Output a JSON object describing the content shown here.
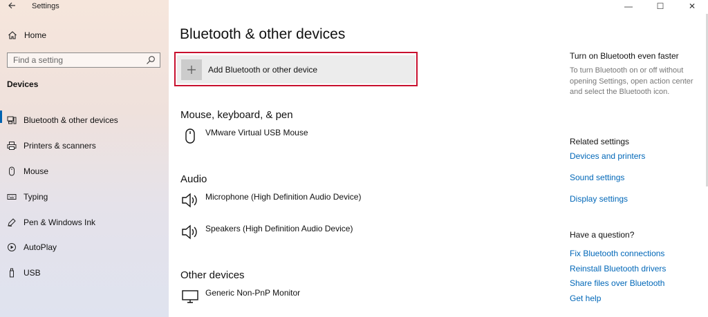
{
  "window": {
    "app_title": "Settings",
    "controls": {
      "minimize": "—",
      "maximize": "☐",
      "close": "✕"
    }
  },
  "sidebar": {
    "home_label": "Home",
    "search": {
      "placeholder": "Find a setting",
      "value": ""
    },
    "section_heading": "Devices",
    "items": [
      {
        "label": "Bluetooth & other devices",
        "icon": "bluetooth-devices-icon",
        "active": true
      },
      {
        "label": "Printers & scanners",
        "icon": "printer-icon",
        "active": false
      },
      {
        "label": "Mouse",
        "icon": "mouse-icon",
        "active": false
      },
      {
        "label": "Typing",
        "icon": "keyboard-icon",
        "active": false
      },
      {
        "label": "Pen & Windows Ink",
        "icon": "pen-icon",
        "active": false
      },
      {
        "label": "AutoPlay",
        "icon": "autoplay-icon",
        "active": false
      },
      {
        "label": "USB",
        "icon": "usb-icon",
        "active": false
      }
    ]
  },
  "main": {
    "title": "Bluetooth & other devices",
    "add_button_label": "Add Bluetooth or other device",
    "groups": [
      {
        "title": "Mouse, keyboard, & pen",
        "devices": [
          {
            "label": "VMware Virtual USB Mouse",
            "icon": "mouse-icon"
          }
        ]
      },
      {
        "title": "Audio",
        "devices": [
          {
            "label": "Microphone (High Definition Audio Device)",
            "icon": "speaker-icon"
          },
          {
            "label": "Speakers (High Definition Audio Device)",
            "icon": "speaker-icon"
          }
        ]
      },
      {
        "title": "Other devices",
        "devices": [
          {
            "label": "Generic Non-PnP Monitor",
            "icon": "monitor-icon"
          }
        ]
      }
    ]
  },
  "right": {
    "tip_heading": "Turn on Bluetooth even faster",
    "tip_text": "To turn Bluetooth on or off without opening Settings, open action center and select the Bluetooth icon.",
    "related_heading": "Related settings",
    "related_links": [
      "Devices and printers",
      "Sound settings",
      "Display settings"
    ],
    "question_heading": "Have a question?",
    "help_links": [
      "Fix Bluetooth connections",
      "Reinstall Bluetooth drivers",
      "Share files over Bluetooth",
      "Get help"
    ]
  },
  "colors": {
    "accent": "#0063b1",
    "link": "#0067b8",
    "highlight_outline": "#c8102e"
  }
}
